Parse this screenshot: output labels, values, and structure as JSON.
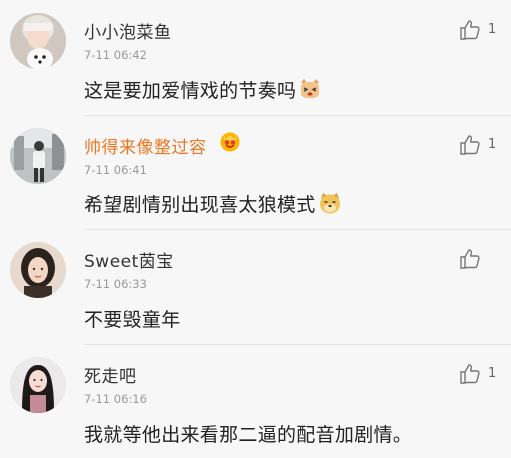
{
  "comments": [
    {
      "username": "小小泡菜鱼",
      "time": "7-11 06:42",
      "text": "这是要加爱情戏的节奏吗",
      "likes": "1",
      "emoji": "cat-face-emoji",
      "avatar": "avatar-woman-with-dog"
    },
    {
      "username": "帅得来像整过容",
      "time": "7-11 06:41",
      "text": "希望剧情别出现喜太狼模式",
      "likes": "1",
      "emoji": "doge-face-emoji",
      "badge": "crown-heart-badge",
      "avatar": "avatar-person-street"
    },
    {
      "username": "Sweet茵宝",
      "time": "7-11 06:33",
      "text": "不要毁童年",
      "likes": "",
      "avatar": "avatar-girl-portrait"
    },
    {
      "username": "死走吧",
      "time": "7-11 06:16",
      "text": "我就等他出来看那二逼的配音加剧情。",
      "likes": "1",
      "avatar": "avatar-girl-long-hair"
    }
  ],
  "colors": {
    "vip_username": "#ee7722",
    "username": "#333333",
    "meta": "#999999",
    "background": "#f7f7f7"
  }
}
